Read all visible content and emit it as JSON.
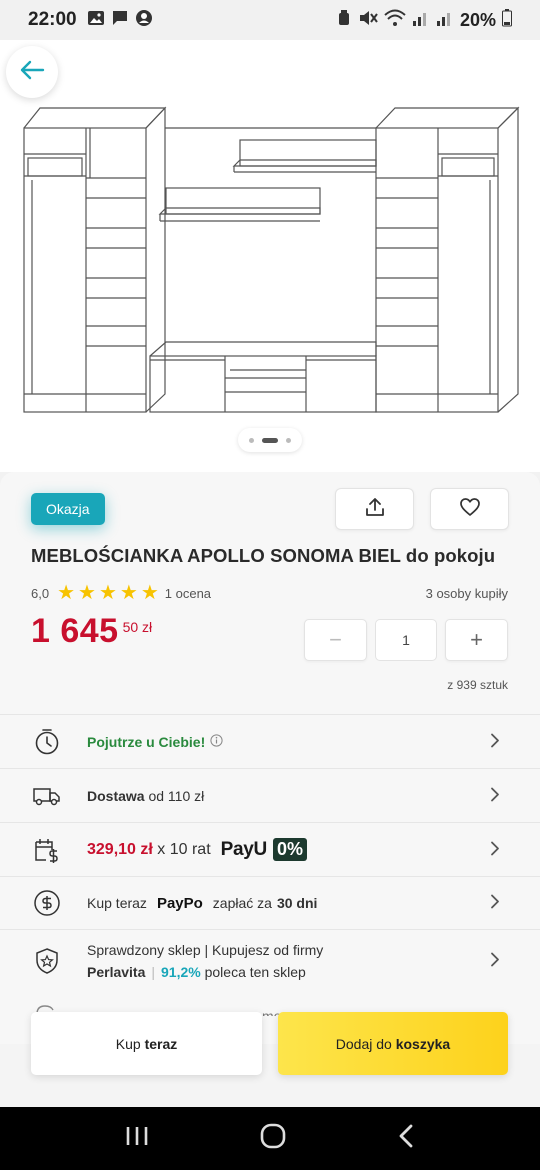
{
  "status_bar": {
    "time": "22:00",
    "battery": "20%"
  },
  "gallery": {
    "dots_count": 3,
    "active_dot": 2
  },
  "product": {
    "badge": "Okazja",
    "title": "MEBLOŚCIANKA APOLLO SONOMA BIEL do pokoju",
    "rating_value": "6,0",
    "stars": 5,
    "rating_count": "1 ocena",
    "buyers": "3 osoby kupiły",
    "price_main": "1 645",
    "price_cents": "50 zł",
    "quantity": "1",
    "qty_minus": "−",
    "qty_plus": "+",
    "stock": "z 939 sztuk"
  },
  "info_rows": {
    "pickup": "Pojutrze u Ciebie!",
    "delivery_bold": "Dostawa",
    "delivery_rest": " od 110 zł",
    "installment_amount": "329,10 zł",
    "installment_rest": " x 10 rat",
    "payu_logo": "PayU",
    "payu_zero": "0%",
    "paypo_prefix": "Kup teraz",
    "paypo_logo": "PayPo",
    "paypo_text": "zapłać za",
    "paypo_days": "30 dni",
    "shop_line1": "Sprawdzony sklep | Kupujesz od firmy",
    "shop_name": "Perlavita",
    "shop_percent": "91,2%",
    "shop_recommend": "poleca ten sklep",
    "partial_text": "mo"
  },
  "actions": {
    "buy_now_prefix": "Kup ",
    "buy_now_bold": "teraz",
    "add_cart_prefix": "Dodaj do ",
    "add_cart_bold": "koszyka"
  },
  "colors": {
    "accent": "#19a6b9",
    "price": "#c8102e",
    "green": "#2a8a3e",
    "cart_button": "#fdd21c"
  }
}
